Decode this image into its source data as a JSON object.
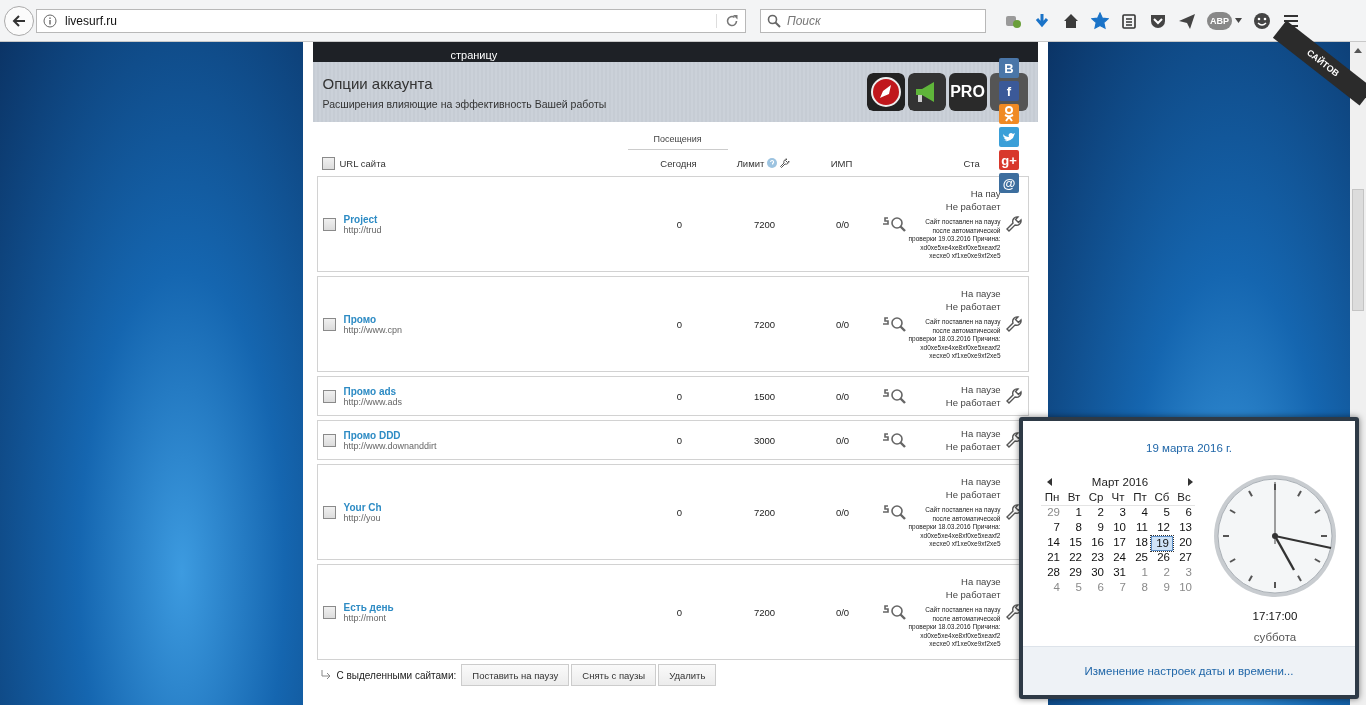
{
  "browser": {
    "url": "livesurf.ru",
    "search_placeholder": "Поиск",
    "abp_label": "ABP",
    "bookmarked": true
  },
  "top_band": {
    "text": "страницу"
  },
  "ribbon": {
    "text": "САЙТОВ"
  },
  "account_options": {
    "title": "Опции аккаунта",
    "subtitle": "Расширения влияющие на эффективность Вашей работы",
    "tiles": [
      {
        "kind": "rocket"
      },
      {
        "kind": "megaphone"
      },
      {
        "kind": "pro",
        "label": "PRO"
      },
      {
        "kind": "photo"
      }
    ]
  },
  "socials": [
    {
      "kind": "letter",
      "label": "В",
      "color": "#4a76a8"
    },
    {
      "kind": "letter",
      "label": "f",
      "color": "#3b5998"
    },
    {
      "kind": "person",
      "color": "#f08a24"
    },
    {
      "kind": "bird",
      "color": "#3a9fd8"
    },
    {
      "kind": "letter",
      "label": "g+",
      "color": "#d8382c"
    },
    {
      "kind": "letter",
      "label": "@",
      "color": "#3d6e9e"
    }
  ],
  "table": {
    "group_header": "Посещения",
    "columns": [
      "URL сайта",
      "Сегодня",
      "Лимит",
      "ИМП",
      "Ста"
    ],
    "select_all_checked": false,
    "rows": [
      {
        "checked": false,
        "name": "Project",
        "url": "http://trud",
        "today": "0",
        "limit": "7200",
        "imp": "0/0",
        "status": [
          "На пау",
          "Не работает"
        ],
        "note": "Сайт поставлен на паузу после автоматической проверки 19.03.2016 Причина: xd0xe5xe4xe8xf0xe5xeaxf2 xecxe0 xf1xe0xe9xf2xe5"
      },
      {
        "checked": false,
        "name": "Промо",
        "url": "http://www.cpn",
        "today": "0",
        "limit": "7200",
        "imp": "0/0",
        "status": [
          "На паузе",
          "Не работает"
        ],
        "note": "Сайт поставлен на паузу после автоматической проверки 18.03.2016 Причина: xd0xe5xe4xe8xf0xe5xeaxf2 xecxe0 xf1xe0xe9xf2xe5"
      },
      {
        "checked": false,
        "name": "Промо ads",
        "url": "http://www.ads",
        "today": "0",
        "limit": "1500",
        "imp": "0/0",
        "status": [
          "На паузе",
          "Не работает"
        ]
      },
      {
        "checked": false,
        "name": "Промо DDD",
        "url": "http://www.downanddirt",
        "today": "0",
        "limit": "3000",
        "imp": "0/0",
        "status": [
          "На паузе",
          "Не работает"
        ]
      },
      {
        "checked": false,
        "name": "Your Ch",
        "url": "http://you",
        "today": "0",
        "limit": "7200",
        "imp": "0/0",
        "status": [
          "На паузе",
          "Не работает"
        ],
        "note": "Сайт поставлен на паузу после автоматической проверки 18.03.2016 Причина: xd0xe5xe4xe8xf0xe5xeaxf2 xecxe0 xf1xe0xe9xf2xe5"
      },
      {
        "checked": false,
        "name": "Есть день",
        "url": "http://mont",
        "today": "0",
        "limit": "7200",
        "imp": "0/0",
        "status": [
          "На паузе",
          "Не работает"
        ],
        "note": "Сайт поставлен на паузу после автоматической проверки 18.03.2016 Причина: xd0xe5xe4xe8xf0xe5xeaxf2 xecxe0 xf1xe0xe9xf2xe5"
      }
    ]
  },
  "bulk": {
    "label": "С выделенными сайтами:",
    "buttons": [
      "Поставить на паузу",
      "Снять с паузы",
      "Удалить"
    ]
  },
  "calendar": {
    "date_title": "19 марта 2016 г.",
    "month": "Март 2016",
    "weekdays": [
      "Пн",
      "Вт",
      "Ср",
      "Чт",
      "Пт",
      "Сб",
      "Вс"
    ],
    "days": [
      {
        "day": "29",
        "muted": true,
        "selected": false
      },
      {
        "day": "1",
        "muted": false,
        "selected": false
      },
      {
        "day": "2",
        "muted": false,
        "selected": false
      },
      {
        "day": "3",
        "muted": false,
        "selected": false
      },
      {
        "day": "4",
        "muted": false,
        "selected": false
      },
      {
        "day": "5",
        "muted": false,
        "selected": false
      },
      {
        "day": "6",
        "muted": false,
        "selected": false
      },
      {
        "day": "7",
        "muted": false,
        "selected": false
      },
      {
        "day": "8",
        "muted": false,
        "selected": false
      },
      {
        "day": "9",
        "muted": false,
        "selected": false
      },
      {
        "day": "10",
        "muted": false,
        "selected": false
      },
      {
        "day": "11",
        "muted": false,
        "selected": false
      },
      {
        "day": "12",
        "muted": false,
        "selected": false
      },
      {
        "day": "13",
        "muted": false,
        "selected": false
      },
      {
        "day": "14",
        "muted": false,
        "selected": false
      },
      {
        "day": "15",
        "muted": false,
        "selected": false
      },
      {
        "day": "16",
        "muted": false,
        "selected": false
      },
      {
        "day": "17",
        "muted": false,
        "selected": false
      },
      {
        "day": "18",
        "muted": false,
        "selected": false
      },
      {
        "day": "19",
        "muted": false,
        "selected": true
      },
      {
        "day": "20",
        "muted": false,
        "selected": false
      },
      {
        "day": "21",
        "muted": false,
        "selected": false
      },
      {
        "day": "22",
        "muted": false,
        "selected": false
      },
      {
        "day": "23",
        "muted": false,
        "selected": false
      },
      {
        "day": "24",
        "muted": false,
        "selected": false
      },
      {
        "day": "25",
        "muted": false,
        "selected": false
      },
      {
        "day": "26",
        "muted": false,
        "selected": false
      },
      {
        "day": "27",
        "muted": false,
        "selected": false
      },
      {
        "day": "28",
        "muted": false,
        "selected": false
      },
      {
        "day": "29",
        "muted": false,
        "selected": false
      },
      {
        "day": "30",
        "muted": false,
        "selected": false
      },
      {
        "day": "31",
        "muted": false,
        "selected": false
      },
      {
        "day": "1",
        "muted": true,
        "selected": false
      },
      {
        "day": "2",
        "muted": true,
        "selected": false
      },
      {
        "day": "3",
        "muted": true,
        "selected": false
      },
      {
        "day": "4",
        "muted": true,
        "selected": false
      },
      {
        "day": "5",
        "muted": true,
        "selected": false
      },
      {
        "day": "6",
        "muted": true,
        "selected": false
      },
      {
        "day": "7",
        "muted": true,
        "selected": false
      },
      {
        "day": "8",
        "muted": true,
        "selected": false
      },
      {
        "day": "9",
        "muted": true,
        "selected": false
      },
      {
        "day": "10",
        "muted": true,
        "selected": false
      }
    ],
    "time": "17:17:00",
    "weekday": "суббота",
    "settings_link": "Изменение настроек даты и времени..."
  }
}
